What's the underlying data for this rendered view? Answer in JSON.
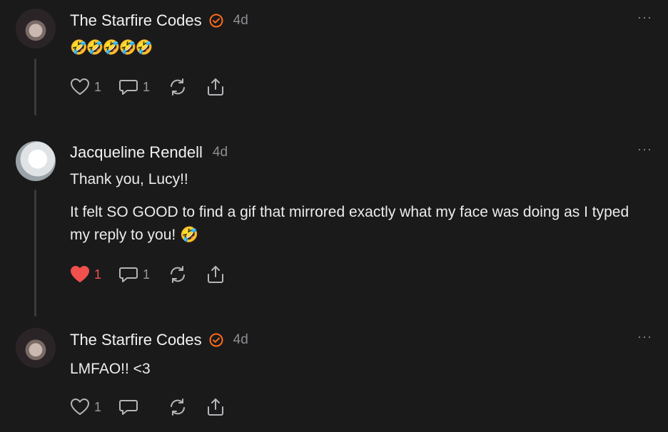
{
  "comments": [
    {
      "author": "The Starfire Codes",
      "time": "4d",
      "more": "···",
      "text": "🤣🤣🤣🤣🤣",
      "likes": "1",
      "replies": "1"
    },
    {
      "author": "Jacqueline Rendell",
      "time": "4d",
      "more": "···",
      "text1": "Thank you, Lucy!!",
      "text2": "It felt SO GOOD to find a gif that mirrored exactly what my face was doing as I typed my reply to you! 🤣",
      "likes": "1",
      "replies": "1"
    },
    {
      "author": "The Starfire Codes",
      "time": "4d",
      "more": "···",
      "text": "LMFAO!! <3",
      "likes": "1",
      "replies": ""
    }
  ],
  "colors": {
    "background": "#1a1a1b",
    "accent_verified": "#ff6b1a",
    "liked_heart": "#f0514d",
    "muted": "#8e8e93"
  }
}
